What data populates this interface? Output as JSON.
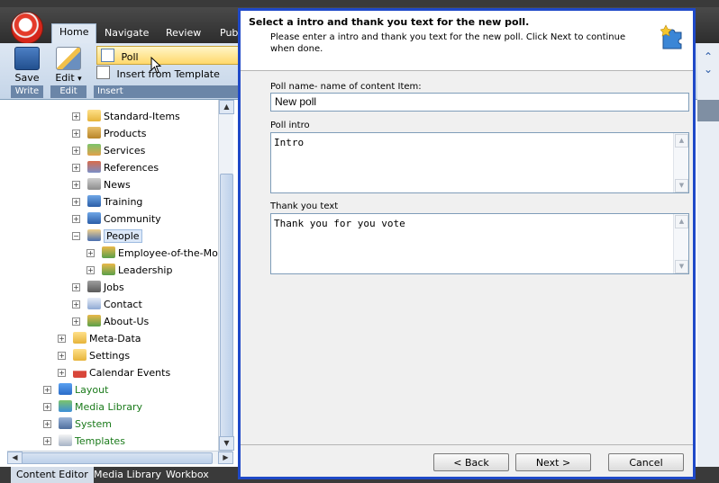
{
  "ribbon": {
    "tabs": [
      "Home",
      "Navigate",
      "Review",
      "Publ"
    ],
    "save_label": "Save",
    "edit_label": "Edit",
    "edit_arrow": "▾",
    "poll_label": "Poll",
    "insert_from_template_label": "Insert from Template",
    "groups": {
      "write": "Write",
      "edit": "Edit",
      "insert": "Insert"
    }
  },
  "tree": {
    "items": [
      {
        "label": "Standard-Items",
        "icon": "folder-icon"
      },
      {
        "label": "Products",
        "icon": "box-icon"
      },
      {
        "label": "Services",
        "icon": "people-icon"
      },
      {
        "label": "References",
        "icon": "user-icon"
      },
      {
        "label": "News",
        "icon": "news-icon"
      },
      {
        "label": "Training",
        "icon": "database-icon"
      },
      {
        "label": "Community",
        "icon": "database-icon"
      },
      {
        "label": "People",
        "icon": "people-board-icon"
      },
      {
        "label": "Employee-of-the-Mont",
        "icon": "group-icon"
      },
      {
        "label": "Leadership",
        "icon": "group-icon"
      },
      {
        "label": "Jobs",
        "icon": "jobs-icon"
      },
      {
        "label": "Contact",
        "icon": "contact-icon"
      },
      {
        "label": "About-Us",
        "icon": "group-icon"
      },
      {
        "label": "Meta-Data",
        "icon": "folder-icon"
      },
      {
        "label": "Settings",
        "icon": "folder-icon"
      },
      {
        "label": "Calendar Events",
        "icon": "calendar-icon"
      },
      {
        "label": "Layout",
        "icon": "layout-icon"
      },
      {
        "label": "Media Library",
        "icon": "image-icon"
      },
      {
        "label": "System",
        "icon": "system-icon"
      },
      {
        "label": "Templates",
        "icon": "template-icon"
      }
    ]
  },
  "bottom_tabs": [
    "Content Editor",
    "Media Library",
    "Workbox"
  ],
  "dialog": {
    "title": "Select a intro and thank you text for the new poll.",
    "description": "Please enter a intro and thank you text for the new poll. Click Next to continue when done.",
    "poll_name_label": "Poll name- name of content Item:",
    "poll_name_value": "New poll",
    "poll_intro_label": "Poll intro",
    "poll_intro_value": "Intro",
    "thank_you_label": "Thank you text",
    "thank_you_value": "Thank you for you vote",
    "back_label": "< Back",
    "next_label": "Next >",
    "cancel_label": "Cancel"
  },
  "colors": {
    "dialog_border": "#1f49c8",
    "ribbon": "#dde7f3",
    "tree_green": "#1a7a1a"
  }
}
